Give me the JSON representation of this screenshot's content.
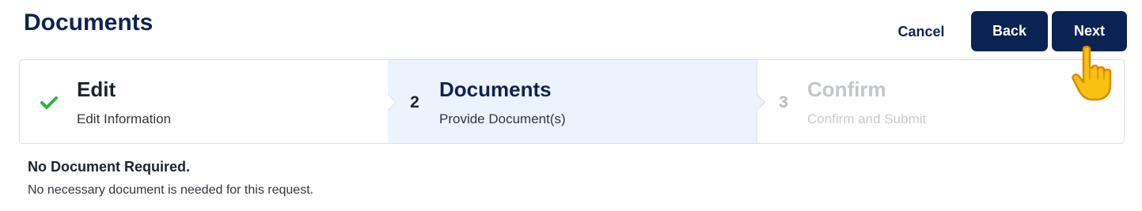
{
  "page": {
    "title": "Documents"
  },
  "actions": {
    "cancel_label": "Cancel",
    "back_label": "Back",
    "next_label": "Next"
  },
  "steps": [
    {
      "marker": "",
      "title": "Edit",
      "subtitle": "Edit Information",
      "state": "completed"
    },
    {
      "marker": "2",
      "title": "Documents",
      "subtitle": "Provide Document(s)",
      "state": "active"
    },
    {
      "marker": "3",
      "title": "Confirm",
      "subtitle": "Confirm and Submit",
      "state": "upcoming"
    }
  ],
  "notice": {
    "title": "No Document Required.",
    "text": "No necessary document is needed for this request."
  },
  "colors": {
    "brand_navy": "#0a2354",
    "active_step_bg": "#edf3fd",
    "check_green": "#2fb344",
    "cursor_yellow": "#f9c112"
  },
  "icons": {
    "completed_step": "check-icon",
    "pointer": "hand-pointer-icon"
  }
}
